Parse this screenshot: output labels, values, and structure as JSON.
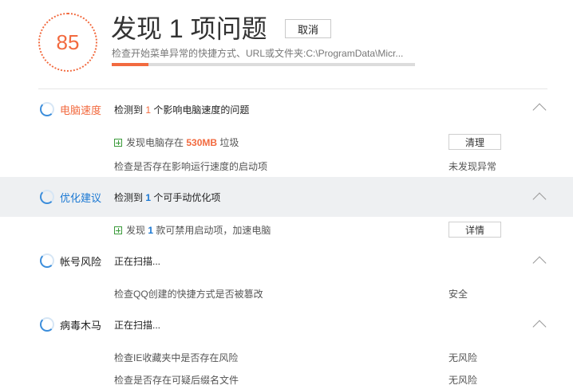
{
  "header": {
    "score": "85",
    "title": "发现 1 项问题",
    "cancel_label": "取消",
    "status_text": "检查开始菜单异常的快捷方式、URL或文件夹:C:\\ProgramData\\Micr...",
    "progress_fraction": 0.12
  },
  "sections": {
    "speed": {
      "label": "电脑速度",
      "text_pre": "检测到",
      "count": "1",
      "text_post": "个影响电脑速度的问题",
      "items": [
        {
          "pre": "发现电脑存在",
          "value": "530MB",
          "post": "垃圾",
          "action": "清理"
        },
        {
          "text": "检查是否存在影响运行速度的启动项",
          "result": "未发现异常"
        }
      ]
    },
    "optimize": {
      "label": "优化建议",
      "text_pre": "检测到",
      "count": "1",
      "text_post": "个可手动优化项",
      "items": [
        {
          "pre": "发现",
          "value": "1",
          "post": "款可禁用启动项，加速电脑",
          "action": "详情"
        }
      ]
    },
    "account": {
      "label": "帐号风险",
      "status": "正在扫描...",
      "items": [
        {
          "text": "检查QQ创建的快捷方式是否被篡改",
          "result": "安全"
        }
      ]
    },
    "virus": {
      "label": "病毒木马",
      "status": "正在扫描...",
      "items": [
        {
          "text": "检查IE收藏夹中是否存在风险",
          "result": "无风险"
        },
        {
          "text": "检查是否存在可疑后缀名文件",
          "result": "无风险"
        }
      ]
    }
  },
  "colors": {
    "accent": "#f26a3f",
    "blue": "#1a78d3",
    "highlight_bg": "#eef0f2"
  }
}
